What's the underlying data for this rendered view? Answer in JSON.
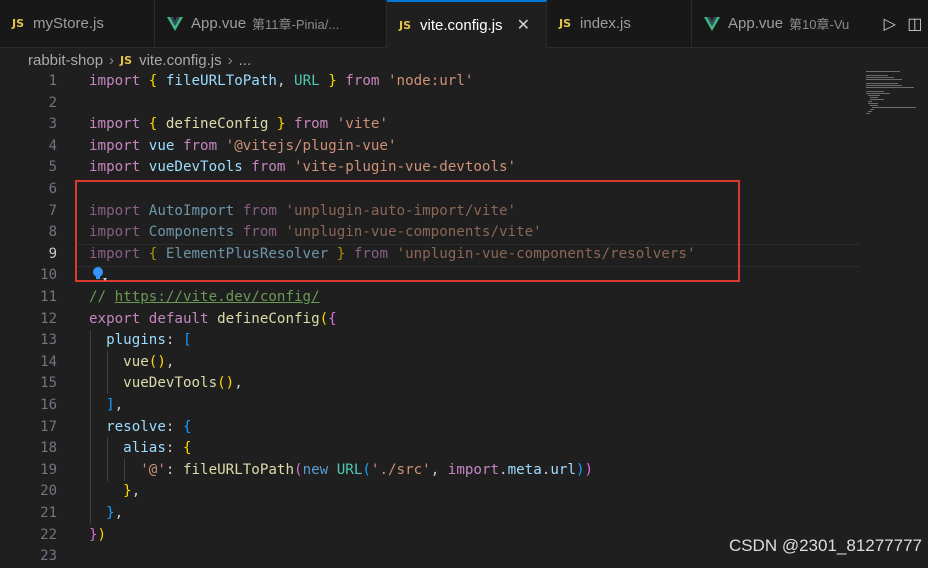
{
  "tabs": [
    {
      "type": "js",
      "label": "myStore.js",
      "sub": "",
      "active": false
    },
    {
      "type": "vue",
      "label": "App.vue",
      "sub": "第11章-Pinia/...",
      "active": false
    },
    {
      "type": "js",
      "label": "vite.config.js",
      "sub": "",
      "active": true
    },
    {
      "type": "js",
      "label": "index.js",
      "sub": "",
      "active": false
    },
    {
      "type": "vue",
      "label": "App.vue",
      "sub": "第10章-Vu",
      "active": false
    }
  ],
  "breadcrumb": {
    "folder": "rabbit-shop",
    "file": "vite.config.js",
    "more": "..."
  },
  "editor": {
    "current_line": 9,
    "lines": [
      {
        "n": "1",
        "tokens": [
          [
            "kw",
            "import "
          ],
          [
            "b1",
            "{ "
          ],
          [
            "var",
            "fileURLToPath"
          ],
          [
            "pun",
            ", "
          ],
          [
            "cls",
            "URL"
          ],
          [
            "b1",
            " }"
          ],
          [
            "kw",
            " from "
          ],
          [
            "str",
            "'node:url'"
          ]
        ]
      },
      {
        "n": "2",
        "tokens": []
      },
      {
        "n": "3",
        "tokens": [
          [
            "kw",
            "import "
          ],
          [
            "b1",
            "{ "
          ],
          [
            "fn",
            "defineConfig"
          ],
          [
            "b1",
            " }"
          ],
          [
            "kw",
            " from "
          ],
          [
            "str",
            "'vite'"
          ]
        ]
      },
      {
        "n": "4",
        "tokens": [
          [
            "kw",
            "import "
          ],
          [
            "var",
            "vue"
          ],
          [
            "kw",
            " from "
          ],
          [
            "str",
            "'@vitejs/plugin-vue'"
          ]
        ]
      },
      {
        "n": "5",
        "tokens": [
          [
            "kw",
            "import "
          ],
          [
            "var",
            "vueDevTools"
          ],
          [
            "kw",
            " from "
          ],
          [
            "str",
            "'vite-plugin-vue-devtools'"
          ]
        ]
      },
      {
        "n": "6",
        "tokens": []
      },
      {
        "n": "7",
        "dim": true,
        "tokens": [
          [
            "kw",
            "import "
          ],
          [
            "var",
            "AutoImport"
          ],
          [
            "kw",
            " from "
          ],
          [
            "str",
            "'unplugin-auto-import/vite'"
          ]
        ]
      },
      {
        "n": "8",
        "dim": true,
        "tokens": [
          [
            "kw",
            "import "
          ],
          [
            "var",
            "Components"
          ],
          [
            "kw",
            " from "
          ],
          [
            "str",
            "'unplugin-vue-components/vite'"
          ]
        ]
      },
      {
        "n": "9",
        "dim": true,
        "tokens": [
          [
            "kw",
            "import "
          ],
          [
            "b1",
            "{ "
          ],
          [
            "var",
            "ElementPlusResolver"
          ],
          [
            "b1",
            " }"
          ],
          [
            "kw",
            " from "
          ],
          [
            "str",
            "'unplugin-vue-components/resolvers'"
          ]
        ]
      },
      {
        "n": "10",
        "tokens": []
      },
      {
        "n": "11",
        "tokens": [
          [
            "com",
            "// "
          ],
          [
            "link",
            "https://vite.dev/config/"
          ]
        ]
      },
      {
        "n": "12",
        "tokens": [
          [
            "kw",
            "export default "
          ],
          [
            "fn",
            "defineConfig"
          ],
          [
            "b1",
            "("
          ],
          [
            "b2",
            "{"
          ]
        ]
      },
      {
        "n": "13",
        "tokens": [
          [
            "pun",
            "  "
          ],
          [
            "var",
            "plugins"
          ],
          [
            "pun",
            ": "
          ],
          [
            "b3",
            "["
          ]
        ]
      },
      {
        "n": "14",
        "tokens": [
          [
            "pun",
            "    "
          ],
          [
            "fn",
            "vue"
          ],
          [
            "b1",
            "()"
          ],
          [
            "pun",
            ","
          ]
        ]
      },
      {
        "n": "15",
        "tokens": [
          [
            "pun",
            "    "
          ],
          [
            "fn",
            "vueDevTools"
          ],
          [
            "b1",
            "()"
          ],
          [
            "pun",
            ","
          ]
        ]
      },
      {
        "n": "16",
        "tokens": [
          [
            "pun",
            "  "
          ],
          [
            "b3",
            "]"
          ],
          [
            "pun",
            ","
          ]
        ]
      },
      {
        "n": "17",
        "tokens": [
          [
            "pun",
            "  "
          ],
          [
            "var",
            "resolve"
          ],
          [
            "pun",
            ": "
          ],
          [
            "b3",
            "{"
          ]
        ]
      },
      {
        "n": "18",
        "tokens": [
          [
            "pun",
            "    "
          ],
          [
            "var",
            "alias"
          ],
          [
            "pun",
            ": "
          ],
          [
            "b1",
            "{"
          ]
        ]
      },
      {
        "n": "19",
        "tokens": [
          [
            "pun",
            "      "
          ],
          [
            "str",
            "'@'"
          ],
          [
            "pun",
            ": "
          ],
          [
            "fn",
            "fileURLToPath"
          ],
          [
            "b2",
            "("
          ],
          [
            "kwb",
            "new "
          ],
          [
            "cls",
            "URL"
          ],
          [
            "b3",
            "("
          ],
          [
            "str",
            "'./src'"
          ],
          [
            "pun",
            ", "
          ],
          [
            "kw",
            "import"
          ],
          [
            "pun",
            "."
          ],
          [
            "var",
            "meta"
          ],
          [
            "pun",
            "."
          ],
          [
            "var",
            "url"
          ],
          [
            "b3",
            ")"
          ],
          [
            "b2",
            ")"
          ]
        ]
      },
      {
        "n": "20",
        "tokens": [
          [
            "pun",
            "    "
          ],
          [
            "b1",
            "}"
          ],
          [
            "pun",
            ","
          ]
        ]
      },
      {
        "n": "21",
        "tokens": [
          [
            "pun",
            "  "
          ],
          [
            "b3",
            "}"
          ],
          [
            "pun",
            ","
          ]
        ]
      },
      {
        "n": "22",
        "tokens": [
          [
            "b2",
            "}"
          ],
          [
            "b1",
            ")"
          ]
        ]
      },
      {
        "n": "23",
        "tokens": []
      }
    ]
  },
  "watermark": "CSDN @2301_81277777",
  "icons": {
    "run": "play-icon",
    "split": "split-editor-icon",
    "bulb": "lightbulb-icon",
    "close": "close-icon"
  }
}
